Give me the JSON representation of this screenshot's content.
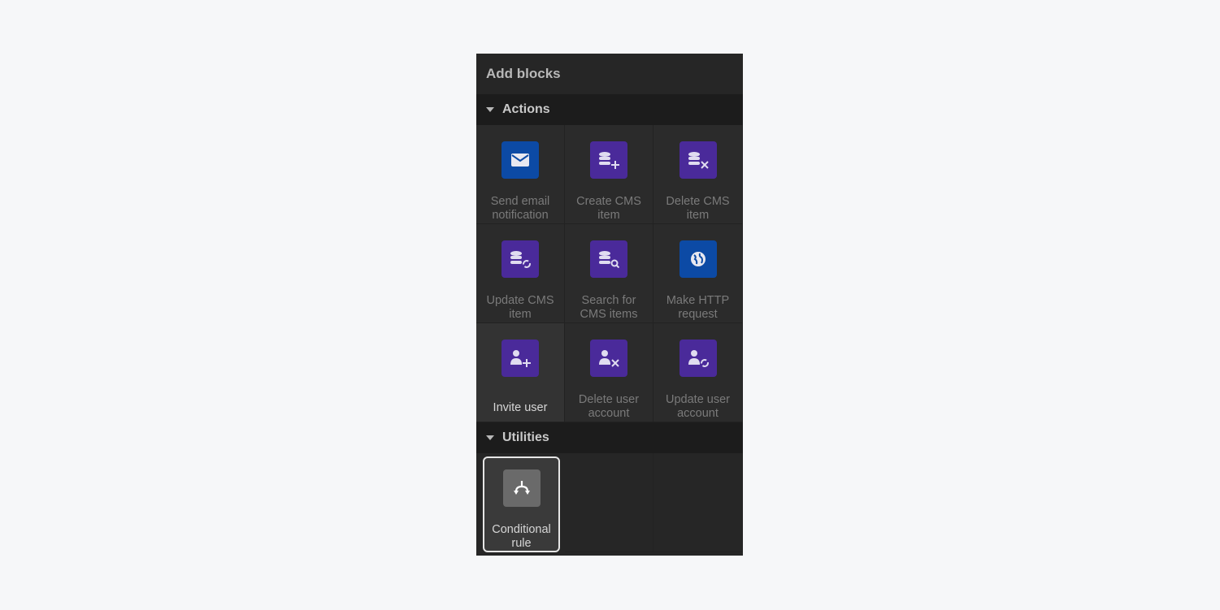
{
  "panel": {
    "title": "Add blocks"
  },
  "sections": {
    "actions": {
      "title": "Actions",
      "items": [
        {
          "label_1": "Send email",
          "label_2": "notification",
          "icon": "envelope-icon"
        },
        {
          "label_1": "Create CMS",
          "label_2": "item",
          "icon": "database-plus-icon"
        },
        {
          "label_1": "Delete CMS",
          "label_2": "item",
          "icon": "database-x-icon"
        },
        {
          "label_1": "Update CMS",
          "label_2": "item",
          "icon": "database-sync-icon"
        },
        {
          "label_1": "Search for",
          "label_2": "CMS items",
          "icon": "database-search-icon"
        },
        {
          "label_1": "Make HTTP",
          "label_2": "request",
          "icon": "globe-icon"
        },
        {
          "label_1": "Invite user",
          "icon": "user-plus-icon"
        },
        {
          "label_1": "Delete user",
          "label_2": "account",
          "icon": "user-x-icon"
        },
        {
          "label_1": "Update user",
          "label_2": "account",
          "icon": "user-sync-icon"
        }
      ]
    },
    "utilities": {
      "title": "Utilities",
      "items": [
        {
          "label_1": "Conditional",
          "label_2": "rule",
          "icon": "branch-icon"
        }
      ]
    }
  },
  "colors": {
    "blue_tile": "#0c4aa5",
    "purple_tile": "#4a2a9a",
    "gray_tile": "#6a6a6a"
  }
}
